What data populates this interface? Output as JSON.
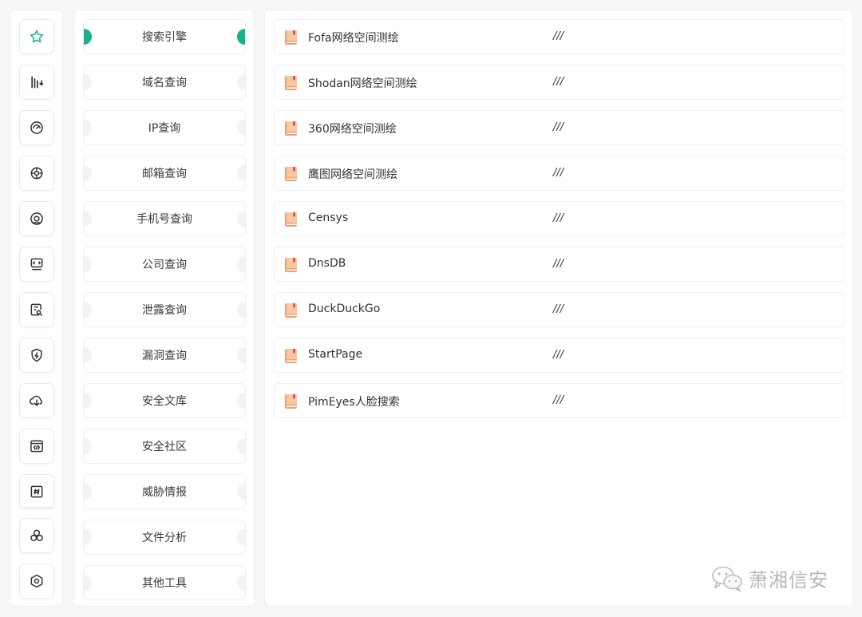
{
  "rail": {
    "icons": [
      "star-icon",
      "chart-icon",
      "gauge-icon",
      "crosshair-icon",
      "at-icon",
      "monitor-code-icon",
      "doc-search-icon",
      "shield-bolt-icon",
      "cloud-download-icon",
      "code-window-icon",
      "hash-icon",
      "circles-icon",
      "hexagon-icon"
    ]
  },
  "categories": [
    {
      "label": "搜索引擎",
      "active": true
    },
    {
      "label": "域名查询"
    },
    {
      "label": "IP查询"
    },
    {
      "label": "邮箱查询"
    },
    {
      "label": "手机号查询"
    },
    {
      "label": "公司查询"
    },
    {
      "label": "泄露查询"
    },
    {
      "label": "漏洞查询"
    },
    {
      "label": "安全文库"
    },
    {
      "label": "安全社区"
    },
    {
      "label": "威胁情报"
    },
    {
      "label": "文件分析"
    },
    {
      "label": "其他工具"
    }
  ],
  "tools": [
    {
      "name": "Fofa网络空间测绘",
      "desc": "///"
    },
    {
      "name": "Shodan网络空间测绘",
      "desc": "///"
    },
    {
      "name": "360网络空间测绘",
      "desc": "///"
    },
    {
      "name": "鹰图网络空间测绘",
      "desc": "///"
    },
    {
      "name": "Censys",
      "desc": "///"
    },
    {
      "name": "DnsDB",
      "desc": "///"
    },
    {
      "name": "DuckDuckGo",
      "desc": "///"
    },
    {
      "name": "StartPage",
      "desc": "///"
    },
    {
      "name": "PimEyes人脸搜索",
      "desc": "///"
    }
  ],
  "watermark": {
    "text": "萧湘信安"
  },
  "colors": {
    "accent": "#16b28a",
    "book": "#f0a070"
  }
}
